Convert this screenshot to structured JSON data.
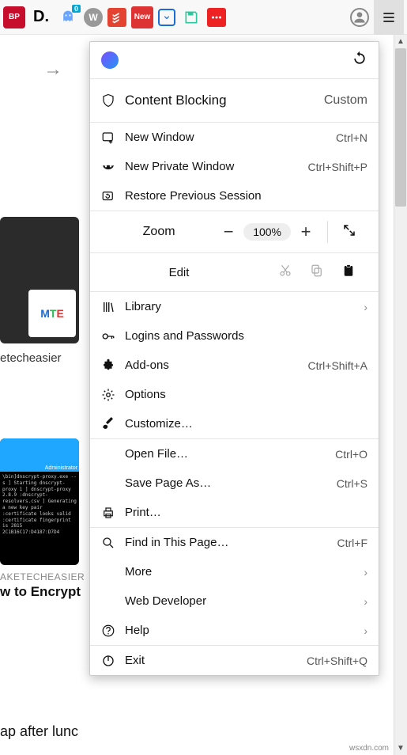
{
  "toolbar": {
    "ext_abp": "BP",
    "ext_d": "D.",
    "ext_ghost_badge": "0",
    "ext_w": "W",
    "ext_new": "New",
    "hamburger": "≡"
  },
  "menu": {
    "content_blocking": {
      "label": "Content Blocking",
      "value": "Custom"
    },
    "new_window": {
      "label": "New Window",
      "shortcut": "Ctrl+N"
    },
    "new_private": {
      "label": "New Private Window",
      "shortcut": "Ctrl+Shift+P"
    },
    "restore": {
      "label": "Restore Previous Session"
    },
    "zoom": {
      "label": "Zoom",
      "value": "100%"
    },
    "edit": {
      "label": "Edit"
    },
    "library": {
      "label": "Library"
    },
    "logins": {
      "label": "Logins and Passwords"
    },
    "addons": {
      "label": "Add-ons",
      "shortcut": "Ctrl+Shift+A"
    },
    "options": {
      "label": "Options"
    },
    "customize": {
      "label": "Customize…"
    },
    "open_file": {
      "label": "Open File…",
      "shortcut": "Ctrl+O"
    },
    "save_page": {
      "label": "Save Page As…",
      "shortcut": "Ctrl+S"
    },
    "print": {
      "label": "Print…"
    },
    "find": {
      "label": "Find in This Page…",
      "shortcut": "Ctrl+F"
    },
    "more": {
      "label": "More"
    },
    "web_dev": {
      "label": "Web Developer"
    },
    "help": {
      "label": "Help"
    },
    "exit": {
      "label": "Exit",
      "shortcut": "Ctrl+Shift+Q"
    }
  },
  "bg": {
    "mte": "MTE",
    "label1": "etecheasier",
    "admin": "Administrator",
    "term": "\\bin]dnscrypt-proxy.exe --s\n] Starting dnscrypt-proxy 1\n] dnscrypt-proxy 2.8.9\n:dnscrypt-resolvers.csv\n] Generating a new key pair\n:certificate looks valid\n:certificate fingerprint is 2815\n2C1B16C17:D4187:D7D4",
    "label2a": "AKETECHEASIER",
    "label2b": "w to Encrypt",
    "label3": "ap after lunc"
  },
  "watermark": "wsxdn.com"
}
